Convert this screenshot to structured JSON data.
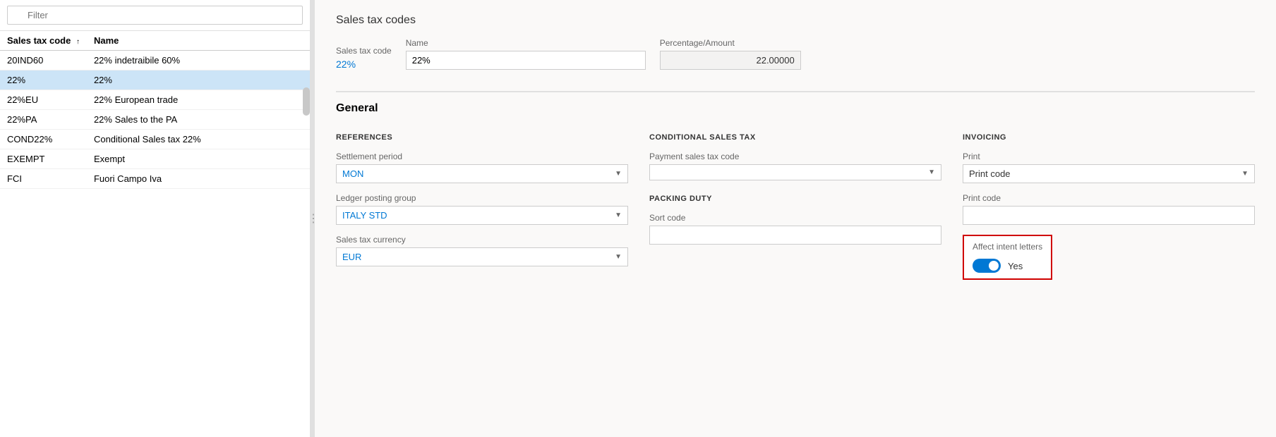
{
  "leftPanel": {
    "filter": {
      "placeholder": "Filter"
    },
    "table": {
      "columns": [
        {
          "label": "Sales tax code",
          "sort": "↑"
        },
        {
          "label": "Name"
        }
      ],
      "rows": [
        {
          "code": "20IND60",
          "name": "22% indetraibile 60%",
          "selected": false
        },
        {
          "code": "22%",
          "name": "22%",
          "selected": true
        },
        {
          "code": "22%EU",
          "name": "22% European trade",
          "selected": false
        },
        {
          "code": "22%PA",
          "name": "22% Sales to the PA",
          "selected": false
        },
        {
          "code": "COND22%",
          "name": "Conditional Sales tax 22%",
          "selected": false
        },
        {
          "code": "EXEMPT",
          "name": "Exempt",
          "selected": false
        },
        {
          "code": "FCI",
          "name": "Fuori Campo Iva",
          "selected": false
        }
      ]
    }
  },
  "rightPanel": {
    "pageTitle": "Sales tax codes",
    "header": {
      "salesTaxCodeLabel": "Sales tax code",
      "salesTaxCodeValue": "22%",
      "nameLabel": "Name",
      "nameValue": "22%",
      "percentageAmountLabel": "Percentage/Amount",
      "percentageAmountValue": "22.00000"
    },
    "general": {
      "sectionTitle": "General",
      "references": {
        "title": "REFERENCES",
        "settlementPeriodLabel": "Settlement period",
        "settlementPeriodValue": "MON",
        "ledgerPostingGroupLabel": "Ledger posting group",
        "ledgerPostingGroupValue": "ITALY STD",
        "salesTaxCurrencyLabel": "Sales tax currency",
        "salesTaxCurrencyValue": "EUR"
      },
      "conditionalSalesTax": {
        "title": "CONDITIONAL SALES TAX",
        "paymentSalesTaxCodeLabel": "Payment sales tax code",
        "paymentSalesTaxCodeValue": "",
        "packingDutyTitle": "PACKING DUTY",
        "sortCodeLabel": "Sort code",
        "sortCodeValue": ""
      },
      "invoicing": {
        "title": "INVOICING",
        "printLabel": "Print",
        "printValue": "Print code",
        "printCodeLabel": "Print code",
        "printCodeValue": "",
        "affectIntentLettersLabel": "Affect intent letters",
        "affectIntentLettersValue": "Yes",
        "toggleState": true
      }
    }
  }
}
